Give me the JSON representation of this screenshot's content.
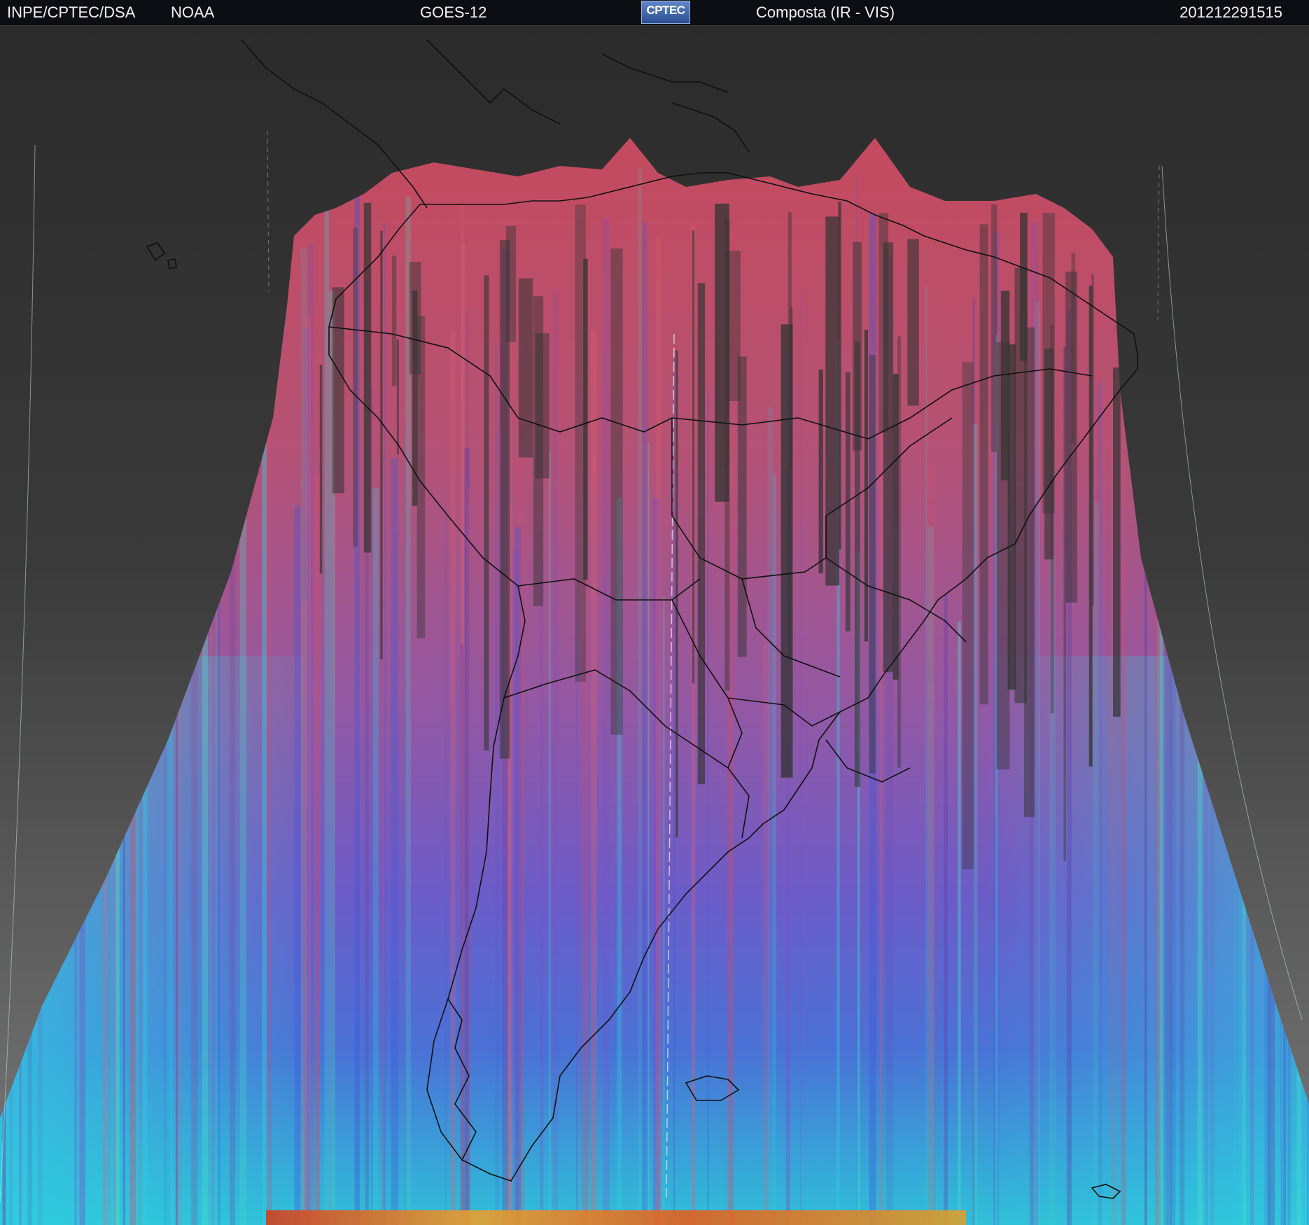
{
  "header": {
    "org": "INPE/CPTEC/DSA",
    "agency": "NOAA",
    "satellite": "GOES-12",
    "logo_text": "CPTEC",
    "product": "Composta (IR - VIS)",
    "timestamp": "201212291515"
  },
  "map": {
    "region": "South America",
    "background_color": "#2e2e2e",
    "coastline_color": "#111111",
    "colorbands": [
      "#c84a5c",
      "#a65a90",
      "#6a58c8",
      "#3f5fd6",
      "#2fb0d8",
      "#40d0c0",
      "#e0a030",
      "#d04020"
    ]
  }
}
